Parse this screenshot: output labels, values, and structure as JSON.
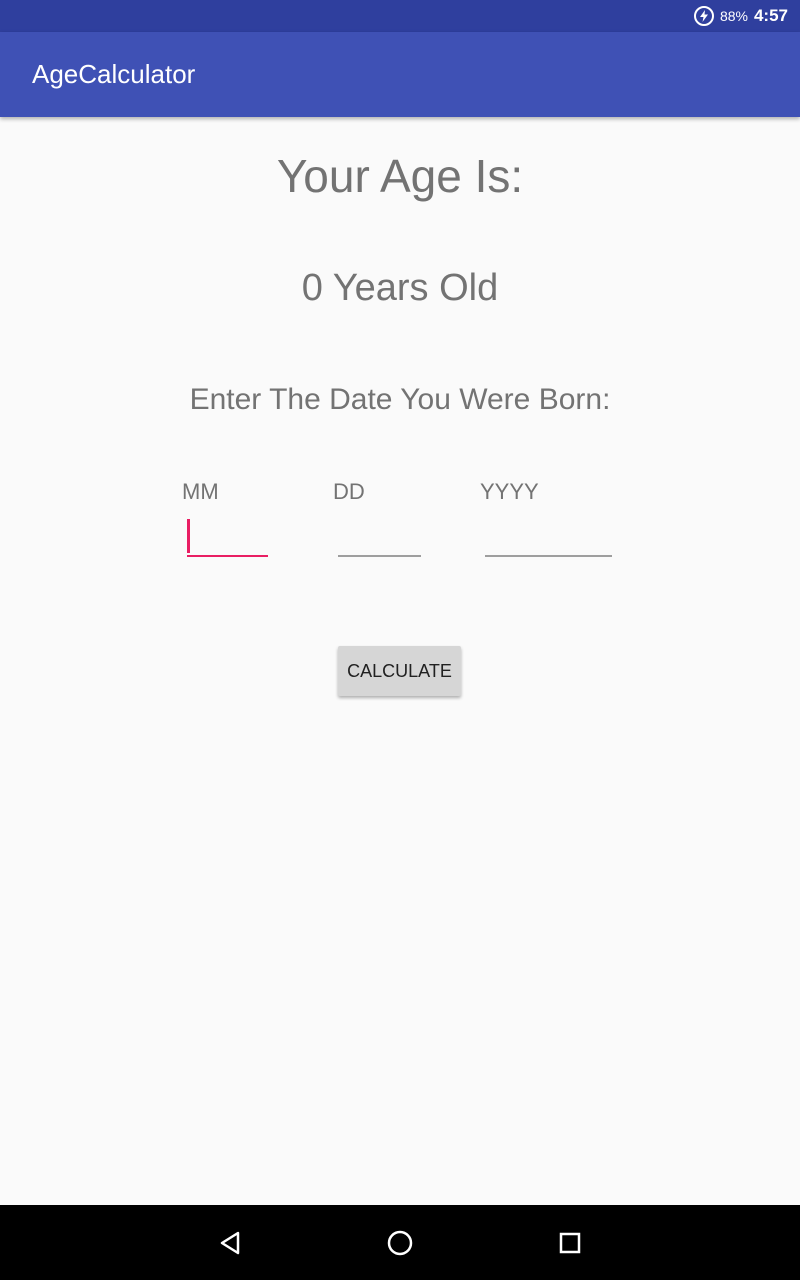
{
  "status_bar": {
    "battery_icon": "battery-charging-icon",
    "battery_percent": "88%",
    "time": "4:57"
  },
  "app_bar": {
    "title": "AgeCalculator",
    "color": "#3f51b5"
  },
  "main": {
    "heading": "Your Age Is:",
    "age_result": "0 Years Old",
    "prompt": "Enter The Date You Were Born:",
    "fields": {
      "month": {
        "label": "MM",
        "value": ""
      },
      "day": {
        "label": "DD",
        "value": ""
      },
      "year": {
        "label": "YYYY",
        "value": ""
      }
    },
    "calculate_button": "CALCULATE",
    "accent_color": "#e91e63"
  },
  "nav_bar": {
    "back_icon": "back-triangle-icon",
    "home_icon": "home-circle-icon",
    "recents_icon": "recents-square-icon"
  }
}
